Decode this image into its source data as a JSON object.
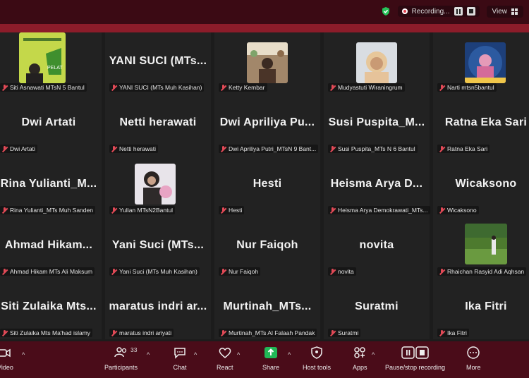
{
  "topbar": {
    "recording_label": "Recording...",
    "view_label": "View"
  },
  "tiles": [
    {
      "big": "",
      "name": "Siti Asnawati MTsN 5 Bantul",
      "photo": "green"
    },
    {
      "big": "YANI SUCI  (MTs...",
      "name": "YANI SUCI (MTs Muh Kasihan)"
    },
    {
      "big": "",
      "name": "Ketty Kembar",
      "photo": "room"
    },
    {
      "big": "",
      "name": "Mudyastuti Wiraningrum",
      "photo": "hijab"
    },
    {
      "big": "",
      "name": "Narti mtsn5bantul",
      "photo": "blue"
    },
    {
      "big": "Dwi Artati",
      "name": "Dwi Artati"
    },
    {
      "big": "Netti herawati",
      "name": "Netti herawati"
    },
    {
      "big": "Dwi  Apriliya  Pu...",
      "name": "Dwi Apriliya Putri_MTsN 9 Bant..."
    },
    {
      "big": "Susi  Puspita_M...",
      "name": "Susi Puspita_MTs N 6 Bantul"
    },
    {
      "big": "Ratna Eka Sari",
      "name": "Ratna Eka Sari"
    },
    {
      "big": "Rina  Yulianti_M...",
      "name": "Rina Yulianti_MTs Muh Sanden"
    },
    {
      "big": "",
      "name": "Yulian MTsN2Bantul",
      "photo": "selfie"
    },
    {
      "big": "Hesti",
      "name": "Hesti"
    },
    {
      "big": "Heisma  Arya  D...",
      "name": "Heisma Arya Demokrawati_MTs..."
    },
    {
      "big": "Wicaksono",
      "name": "Wicaksono"
    },
    {
      "big": "Ahmad  Hikam...",
      "name": "Ahmad Hikam MTs Ali Maksum"
    },
    {
      "big": "Yani  Suci  (MTs...",
      "name": "Yani Suci (MTs Muh Kasihan)"
    },
    {
      "big": "Nur Faiqoh",
      "name": "Nur Faiqoh"
    },
    {
      "big": "novita",
      "name": "novita"
    },
    {
      "big": "",
      "name": "Rhaichan Rasyid Adi Aqhsan",
      "photo": "garden"
    },
    {
      "big": "Siti  Zulaika  Mts...",
      "name": "Siti Zulaika Mts Ma'had islamy"
    },
    {
      "big": "maratus  indri  ar...",
      "name": "maratus indri ariyati"
    },
    {
      "big": "Murtinah_MTs...",
      "name": "Murtinah_MTs Al Falaah Pandak"
    },
    {
      "big": "Suratmi",
      "name": "Suratmi"
    },
    {
      "big": "Ika Fitri",
      "name": "Ika Fitri"
    }
  ],
  "toolbar": {
    "video": "Video",
    "participants": "Participants",
    "participants_count": "33",
    "chat": "Chat",
    "react": "React",
    "share": "Share",
    "host_tools": "Host tools",
    "apps": "Apps",
    "pause_stop": "Pause/stop recording",
    "more": "More"
  }
}
